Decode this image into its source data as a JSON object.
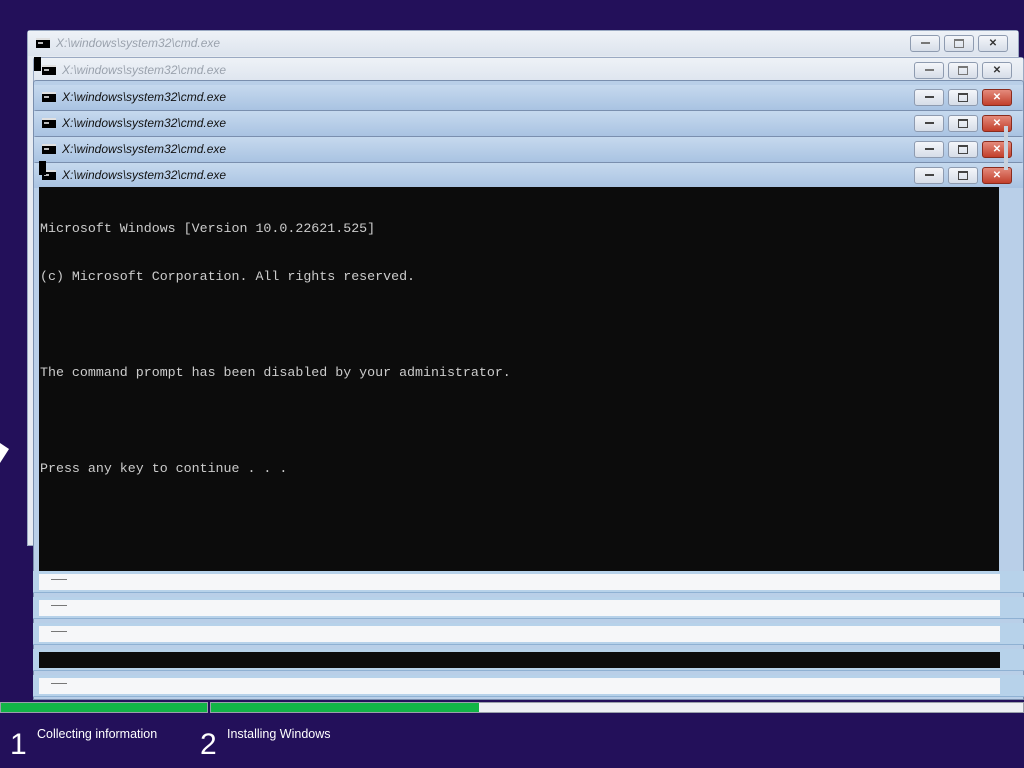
{
  "windows": [
    {
      "title": "X:\\windows\\system32\\cmd.exe"
    },
    {
      "title": "X:\\windows\\system32\\cmd.exe"
    },
    {
      "title": "X:\\windows\\system32\\cmd.exe"
    },
    {
      "title": "X:\\windows\\system32\\cmd.exe"
    },
    {
      "title": "X:\\windows\\system32\\cmd.exe"
    },
    {
      "title": "X:\\windows\\system32\\cmd.exe"
    }
  ],
  "console": {
    "line1": "Microsoft Windows [Version 10.0.22621.525]",
    "line2": "(c) Microsoft Corporation. All rights reserved.",
    "line3": "The command prompt has been disabled by your administrator.",
    "line4": "Press any key to continue . . ."
  },
  "controls": {
    "close_glyph": "✕"
  },
  "setup": {
    "steps": [
      {
        "number": "1",
        "label": "Collecting information",
        "progress": 1.0
      },
      {
        "number": "2",
        "label": "Installing Windows",
        "progress": 0.33
      }
    ],
    "accent": "#12b447",
    "background": "#23105a"
  }
}
